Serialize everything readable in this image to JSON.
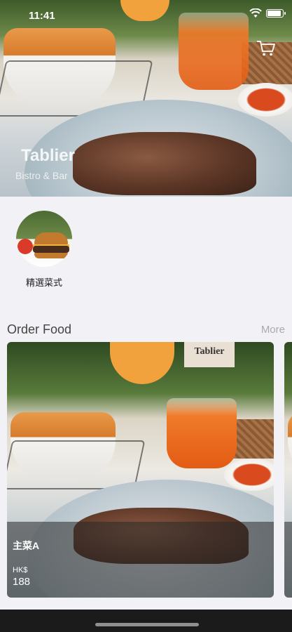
{
  "status_bar": {
    "time": "11:41"
  },
  "hero": {
    "brand_title": "Tablier",
    "brand_subtitle": "Bistro & Bar",
    "cart_icon": "cart-icon"
  },
  "categories": [
    {
      "label": "精選菜式",
      "icon": "burger-image"
    }
  ],
  "section": {
    "title": "Order Food",
    "more_label": "More"
  },
  "items": [
    {
      "name": "主菜A",
      "currency": "HK$",
      "price": "188"
    },
    {
      "name": "",
      "currency": "",
      "price": ""
    }
  ],
  "sign_text": "Tablier",
  "colors": {
    "background": "#f2f1f6",
    "card_overlay": "#282828",
    "bottom_bar": "#1b1b1b"
  }
}
